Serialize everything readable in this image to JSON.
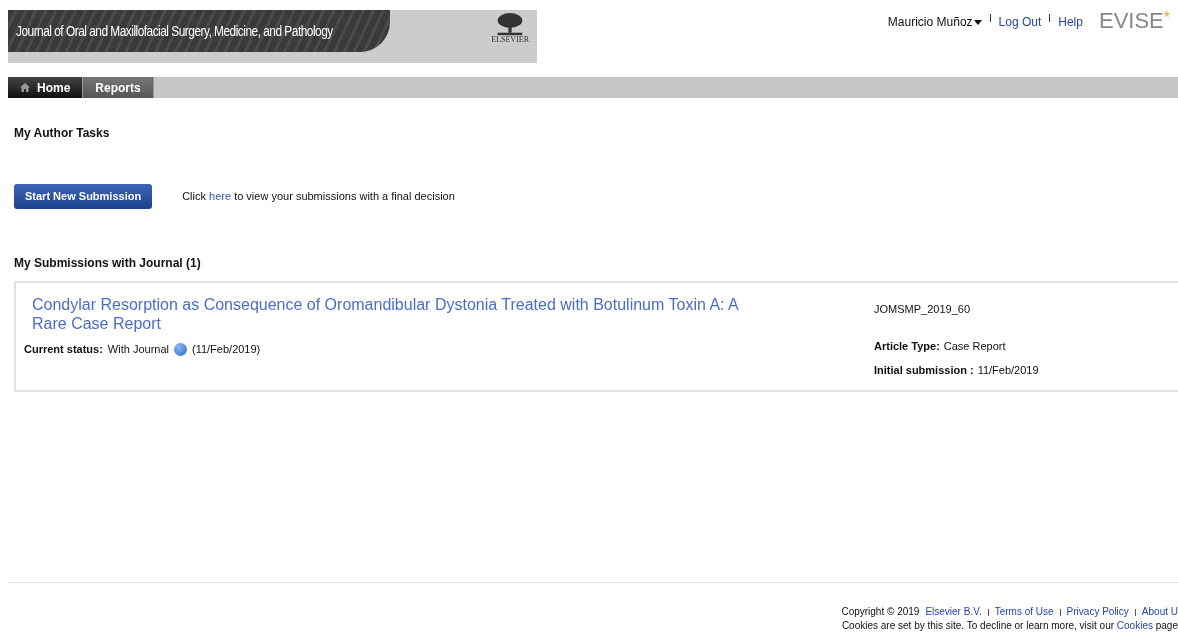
{
  "header": {
    "journal_title": "Journal of Oral and Maxillofacial Surgery, Medicine, and Pathology",
    "publisher_logo": "ELSEVIER",
    "user_menu": "Mauricio Muñoz",
    "links": [
      "Log Out",
      "Help"
    ],
    "app_logo": "EVISE",
    "app_logo_mark": "*"
  },
  "nav_tabs": [
    {
      "label": "Home",
      "selected": true,
      "kind": "home"
    },
    {
      "label": "Reports",
      "selected": false,
      "kind": "plain"
    }
  ],
  "tasks_heading": "My Author Tasks",
  "start_button": "Start New Submission",
  "final_decision": {
    "before": "Click",
    "link": "here",
    "after": "to view your submissions with a final decision"
  },
  "submissions_heading": "My Submissions with Journal (1)",
  "submissions": [
    {
      "title": "Condylar Resorption as Consequence of Oromandibular Dystonia Treated with Botulinum Toxin A: A Rare Case Report",
      "status_label": "Current status:",
      "status": "With Journal",
      "status_date": "(11/Feb/2019)",
      "manuscript_id": "JOMSMP_2019_60",
      "article_type_label": "Article Type:",
      "article_type": "Case Report",
      "initial_label": "Initial submission :",
      "initial_date": "11/Feb/2019"
    }
  ],
  "footer": {
    "copyright": "Copyright © 2019",
    "links": [
      "Elsevier B.V.",
      "Terms of Use",
      "Privacy Policy",
      "About U"
    ],
    "cookies_before": "Cookies are set by this site. To decline or learn more, visit our",
    "cookies_link": "Cookies",
    "cookies_after": "page"
  }
}
